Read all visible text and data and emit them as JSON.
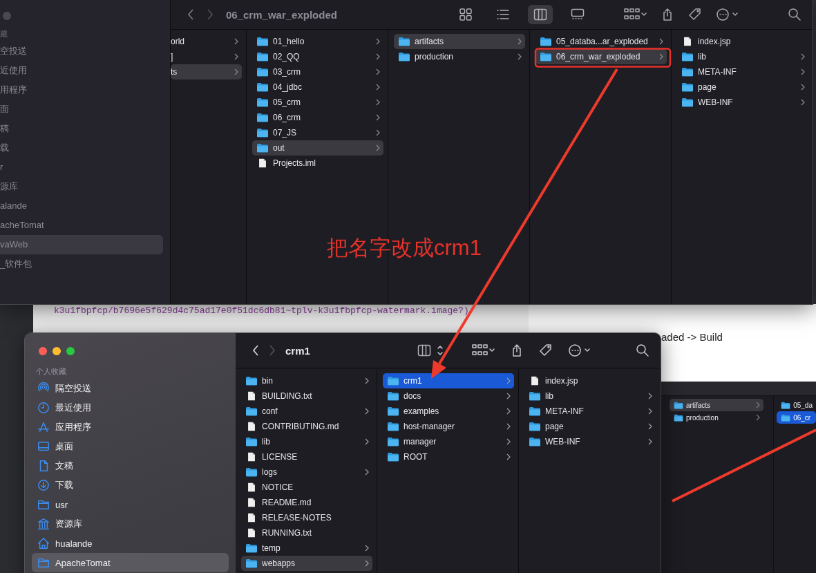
{
  "background": {
    "code_line": "k3u1fbpfcp/b7696e5f629d4c75ad17e0f51dc6db81~tplv-k3u1fbpfcp-watermark.image?)",
    "doc_text": "aded -> Build"
  },
  "windows": [
    {
      "active": false,
      "title": "06_crm_war_exploded",
      "forward_enabled": false,
      "view_modes": [
        {
          "kind": "icons",
          "selected": false
        },
        {
          "kind": "list",
          "selected": false
        },
        {
          "kind": "columns",
          "selected": true
        },
        {
          "kind": "gallery",
          "selected": false
        }
      ],
      "sidebar": {
        "header": "藏",
        "items": [
          {
            "label": "空投送",
            "selected": false
          },
          {
            "label": "近使用",
            "selected": false
          },
          {
            "label": "用程序",
            "selected": false
          },
          {
            "label": "面",
            "selected": false
          },
          {
            "label": "稿",
            "selected": false
          },
          {
            "label": "载",
            "selected": false
          },
          {
            "label": "r",
            "selected": false
          },
          {
            "label": "源库",
            "selected": false
          },
          {
            "label": "alande",
            "selected": false
          },
          {
            "label": "acheTomat",
            "selected": false
          },
          {
            "label": "vaWeb",
            "selected": true
          },
          {
            "label": "_软件包",
            "selected": false
          }
        ]
      },
      "columns": [
        {
          "focused": false,
          "items": [
            {
              "label": "orld",
              "kind": "cut",
              "selected": false
            },
            {
              "label": "]",
              "kind": "cut",
              "selected": false
            },
            {
              "label": "ts",
              "kind": "cut",
              "selected": true
            }
          ]
        },
        {
          "focused": false,
          "items": [
            {
              "label": "01_hello",
              "kind": "folder",
              "selected": false
            },
            {
              "label": "02_QQ",
              "kind": "folder",
              "selected": false
            },
            {
              "label": "03_crm",
              "kind": "folder",
              "selected": false
            },
            {
              "label": "04_jdbc",
              "kind": "folder",
              "selected": false
            },
            {
              "label": "05_crm",
              "kind": "folder",
              "selected": false
            },
            {
              "label": "06_crm",
              "kind": "folder",
              "selected": false
            },
            {
              "label": "07_JS",
              "kind": "folder",
              "selected": false
            },
            {
              "label": "out",
              "kind": "folder",
              "selected": true
            },
            {
              "label": "Projects.iml",
              "kind": "file",
              "selected": false
            }
          ]
        },
        {
          "focused": false,
          "items": [
            {
              "label": "artifacts",
              "kind": "folder",
              "selected": true
            },
            {
              "label": "production",
              "kind": "folder",
              "selected": false
            }
          ]
        },
        {
          "focused": false,
          "items": [
            {
              "label": "05_databa...ar_exploded",
              "kind": "folder",
              "selected": false
            },
            {
              "label": "06_crm_war_exploded",
              "kind": "folder",
              "selected": true
            }
          ]
        },
        {
          "items": [
            {
              "label": "index.jsp",
              "kind": "file",
              "selected": false
            },
            {
              "label": "lib",
              "kind": "folder",
              "selected": false
            },
            {
              "label": "META-INF",
              "kind": "folder",
              "selected": false
            },
            {
              "label": "page",
              "kind": "folder",
              "selected": false
            },
            {
              "label": "WEB-INF",
              "kind": "folder",
              "selected": false
            }
          ]
        }
      ]
    },
    {
      "active": true,
      "title": "crm1",
      "forward_enabled": false,
      "view_modes": [
        {
          "kind": "columns",
          "selected": false
        }
      ],
      "sidebar": {
        "header": "个人收藏",
        "items": [
          {
            "label": "隔空投送",
            "selected": false
          },
          {
            "label": "最近使用",
            "selected": false
          },
          {
            "label": "应用程序",
            "selected": false
          },
          {
            "label": "桌面",
            "selected": false
          },
          {
            "label": "文稿",
            "selected": false
          },
          {
            "label": "下载",
            "selected": false
          },
          {
            "label": "usr",
            "selected": false
          },
          {
            "label": "资源库",
            "selected": false
          },
          {
            "label": "hualande",
            "selected": false
          },
          {
            "label": "ApacheTomat",
            "selected": true
          }
        ]
      },
      "columns": [
        {
          "focused": false,
          "items": [
            {
              "label": "bin",
              "kind": "folder",
              "selected": false
            },
            {
              "label": "BUILDING.txt",
              "kind": "file",
              "selected": false
            },
            {
              "label": "conf",
              "kind": "folder",
              "selected": false
            },
            {
              "label": "CONTRIBUTING.md",
              "kind": "file",
              "selected": false
            },
            {
              "label": "lib",
              "kind": "folder",
              "selected": false
            },
            {
              "label": "LICENSE",
              "kind": "file",
              "selected": false
            },
            {
              "label": "logs",
              "kind": "folder",
              "selected": false
            },
            {
              "label": "NOTICE",
              "kind": "file",
              "selected": false
            },
            {
              "label": "README.md",
              "kind": "file",
              "selected": false
            },
            {
              "label": "RELEASE-NOTES",
              "kind": "file",
              "selected": false
            },
            {
              "label": "RUNNING.txt",
              "kind": "file",
              "selected": false
            },
            {
              "label": "temp",
              "kind": "folder",
              "selected": false
            },
            {
              "label": "webapps",
              "kind": "folder",
              "selected": true
            }
          ]
        },
        {
          "focused": true,
          "items": [
            {
              "label": "crm1",
              "kind": "folder",
              "selected": true
            },
            {
              "label": "docs",
              "kind": "folder",
              "selected": false
            },
            {
              "label": "examples",
              "kind": "folder",
              "selected": false
            },
            {
              "label": "host-manager",
              "kind": "folder",
              "selected": false
            },
            {
              "label": "manager",
              "kind": "folder",
              "selected": false
            },
            {
              "label": "ROOT",
              "kind": "folder",
              "selected": false
            }
          ]
        },
        {
          "items": [
            {
              "label": "index.jsp",
              "kind": "file",
              "selected": false
            },
            {
              "label": "lib",
              "kind": "folder",
              "selected": false
            },
            {
              "label": "META-INF",
              "kind": "folder",
              "selected": false
            },
            {
              "label": "page",
              "kind": "folder",
              "selected": false
            },
            {
              "label": "WEB-INF",
              "kind": "folder",
              "selected": false
            }
          ]
        }
      ]
    }
  ],
  "background_finder": {
    "columns": [
      {
        "focused": false,
        "items": [
          {
            "label": "artifacts",
            "kind": "folder",
            "selected": true
          },
          {
            "label": "production",
            "kind": "folder",
            "selected": false
          }
        ]
      },
      {
        "focused": true,
        "items": [
          {
            "label": "05_da",
            "kind": "folder",
            "selected": false
          },
          {
            "label": "06_cr",
            "kind": "folder",
            "selected": true
          }
        ]
      }
    ]
  },
  "annotation": {
    "label": "把名字改成crm1"
  }
}
